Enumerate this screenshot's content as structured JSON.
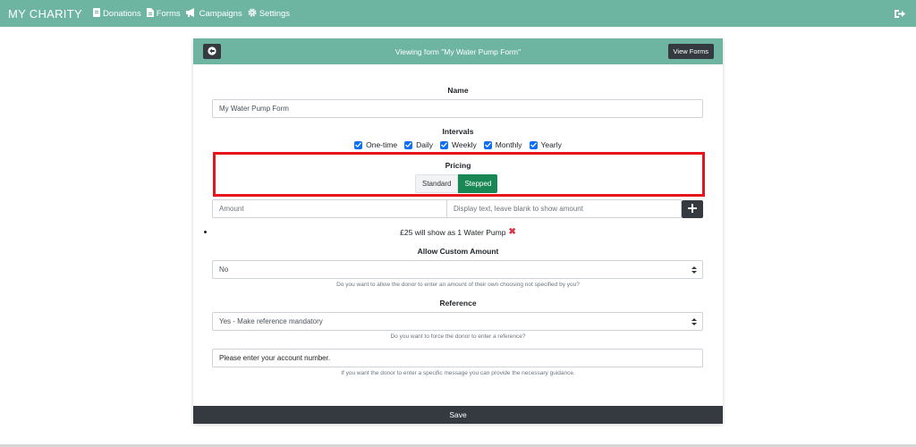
{
  "nav": {
    "brand": "MY CHARITY",
    "items": [
      {
        "label": "Donations",
        "icon": "donations-icon"
      },
      {
        "label": "Forms",
        "icon": "forms-icon"
      },
      {
        "label": "Campaigns",
        "icon": "megaphone-icon"
      },
      {
        "label": "Settings",
        "icon": "gear-icon"
      }
    ],
    "logout_icon": "sign-out-icon"
  },
  "card": {
    "title": "Viewing form \"My Water Pump Form\"",
    "view_forms_label": "View Forms"
  },
  "form": {
    "name_label": "Name",
    "name_value": "My Water Pump Form",
    "intervals_label": "Intervals",
    "intervals": [
      {
        "label": "One-time",
        "checked": true
      },
      {
        "label": "Daily",
        "checked": true
      },
      {
        "label": "Weekly",
        "checked": true
      },
      {
        "label": "Monthly",
        "checked": true
      },
      {
        "label": "Yearly",
        "checked": true
      }
    ],
    "pricing_label": "Pricing",
    "pricing_options": [
      "Standard",
      "Stepped"
    ],
    "pricing_selected": "Stepped",
    "amount_placeholder": "Amount",
    "display_text_placeholder": "Display text, leave blank to show amount",
    "show_as_text": "£25 will show as 1 Water Pump",
    "allow_custom_label": "Allow Custom Amount",
    "allow_custom_value": "No",
    "allow_custom_help": "Do you want to allow the donor to enter an amount of their own choosing not specified by you?",
    "reference_label": "Reference",
    "reference_value": "Yes - Make reference mandatory",
    "reference_help": "Do you want to force the donor to enter a reference?",
    "reference_guidance_value": "Please enter your account number.",
    "reference_guidance_help": "If you want the donor to enter a specific message you can provide the necessary guidance.",
    "save_label": "Save"
  },
  "colors": {
    "header": "#6db5a0",
    "dark": "#343a40",
    "checkbox": "#0d6efd",
    "stepped": "#198754",
    "highlight": "#e8141b",
    "remove": "#dc3545"
  }
}
